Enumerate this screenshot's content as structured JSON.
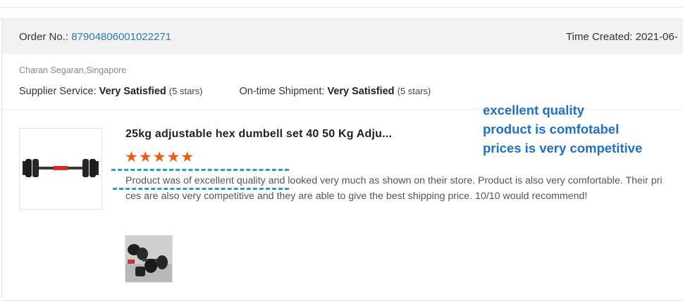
{
  "order": {
    "label": "Order No.:",
    "number": "87904806001022271",
    "time_created": "Time Created: 2021-06-"
  },
  "customer": {
    "name_location": "Charan Segaran,Singapore"
  },
  "ratings": {
    "supplier_label": "Supplier Service:",
    "supplier_value": "Very Satisfied",
    "supplier_stars": "(5 stars)",
    "shipment_label": "On-time Shipment:",
    "shipment_value": "Very Satisfied",
    "shipment_stars": "(5 stars)"
  },
  "product": {
    "title": "25kg adjustable hex dumbell set 40 50 Kg Adju...",
    "rating": 5,
    "stars": "★★★★★",
    "review": "Product was of excellent quality and looked very much as shown on their store. Product is also very comfortable. Their prices are also very competitive and they are able to give the best shipping price. 10/10 would recommend!"
  },
  "annotation": {
    "lines": [
      "excellent quality",
      "product is comfotabel",
      "prices is very competitive"
    ]
  },
  "colors": {
    "link": "#2a7ac0",
    "stars": "#ef5a12",
    "annotation": "#1f6fce",
    "highlight_dash": "#24a3c7"
  },
  "icons": {
    "product": "dumbbell-image",
    "review_photo": "dumbbell-photo"
  }
}
